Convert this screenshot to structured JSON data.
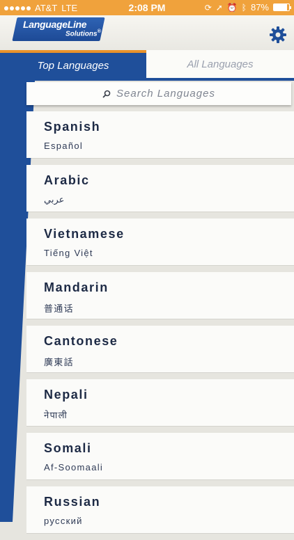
{
  "status_bar": {
    "carrier": "AT&T",
    "network": "LTE",
    "time": "2:08 PM",
    "battery_percent": "87%",
    "battery_level": 0.87,
    "icons": [
      "signal-dots-icon",
      "rotation-lock-icon",
      "location-arrow-icon",
      "alarm-icon",
      "bluetooth-icon",
      "battery-icon"
    ]
  },
  "header": {
    "logo_line1": "LanguageLine",
    "logo_line2": "Solutions",
    "logo_mark": "®",
    "settings_icon": "gear-icon"
  },
  "tabs": [
    {
      "label": "Top Languages",
      "active": true
    },
    {
      "label": "All Languages",
      "active": false
    }
  ],
  "search": {
    "placeholder": "Search Languages",
    "icon": "search-icon"
  },
  "languages": [
    {
      "name": "Spanish",
      "native": "Español"
    },
    {
      "name": "Arabic",
      "native": "عربي"
    },
    {
      "name": "Vietnamese",
      "native": "Tiếng Việt"
    },
    {
      "name": "Mandarin",
      "native": "普通话"
    },
    {
      "name": "Cantonese",
      "native": "廣東話"
    },
    {
      "name": "Nepali",
      "native": "नेपाली"
    },
    {
      "name": "Somali",
      "native": "Af-Soomaali"
    },
    {
      "name": "Russian",
      "native": "русский"
    }
  ],
  "colors": {
    "accent_orange": "#f0a23c",
    "brand_blue": "#1f4f9a",
    "text_dark": "#1d2a45"
  }
}
